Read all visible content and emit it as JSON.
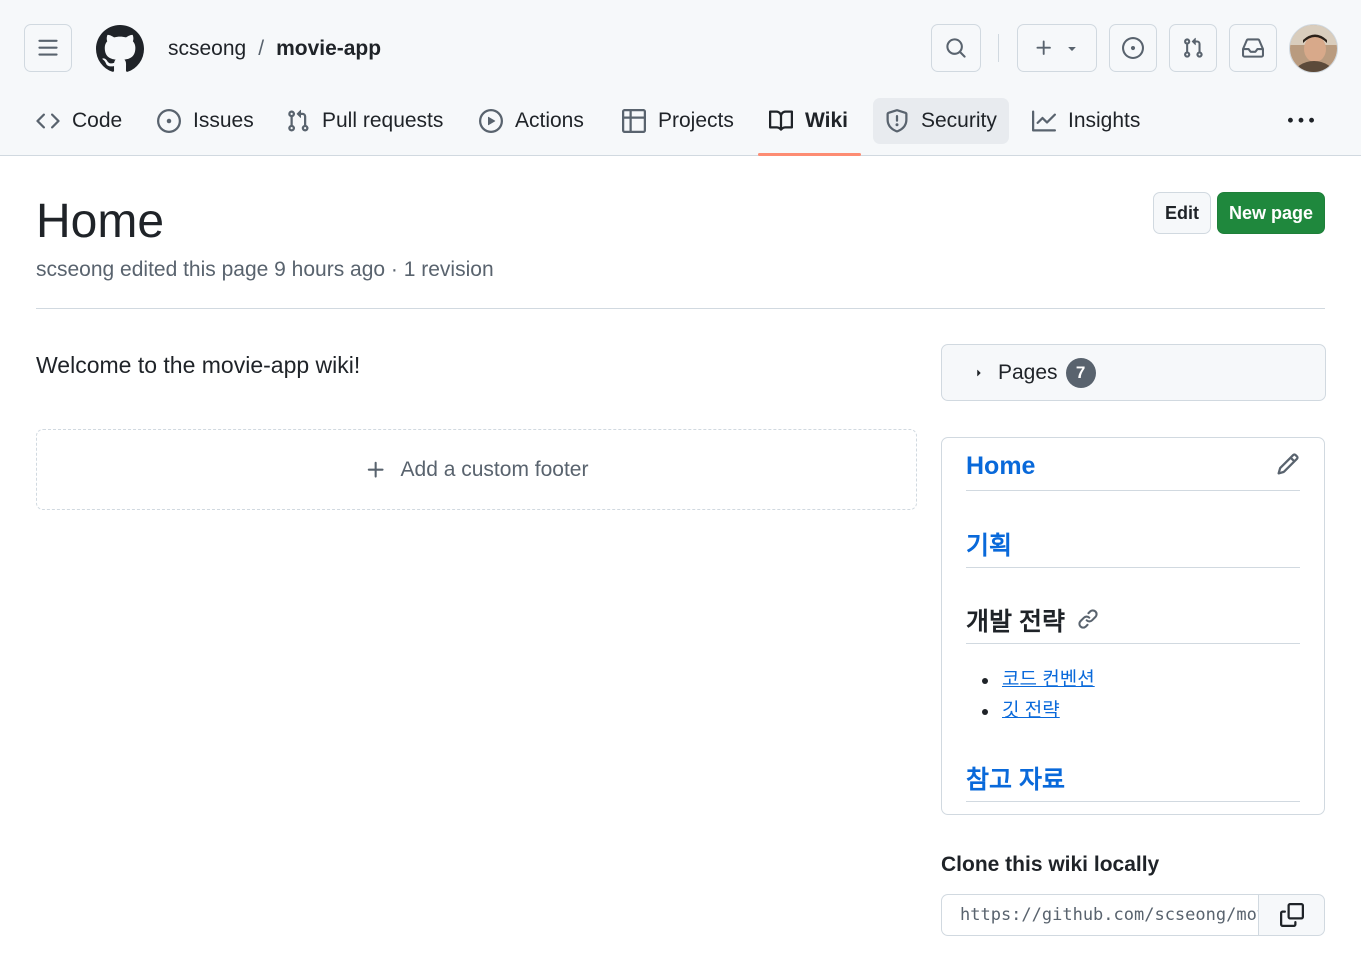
{
  "header": {
    "owner": "scseong",
    "separator": "/",
    "repo": "movie-app"
  },
  "nav": {
    "items": [
      {
        "label": "Code",
        "icon": "code-icon"
      },
      {
        "label": "Issues",
        "icon": "issue-opened-icon"
      },
      {
        "label": "Pull requests",
        "icon": "git-pull-request-icon"
      },
      {
        "label": "Actions",
        "icon": "play-icon"
      },
      {
        "label": "Projects",
        "icon": "table-icon"
      },
      {
        "label": "Wiki",
        "icon": "book-icon"
      },
      {
        "label": "Security",
        "icon": "shield-icon"
      },
      {
        "label": "Insights",
        "icon": "graph-icon"
      }
    ],
    "active": "Wiki"
  },
  "page": {
    "title": "Home",
    "meta": "scseong edited this page 9 hours ago · 1 revision",
    "edit_label": "Edit",
    "new_page_label": "New page",
    "welcome": "Welcome to the movie-app wiki!",
    "add_footer_label": "Add a custom footer"
  },
  "sidebar": {
    "pages_label": "Pages",
    "pages_count": "7",
    "home": "Home",
    "plan": "기획",
    "dev_strategy": "개발 전략",
    "links": [
      "코드 컨벤션",
      "깃 전략"
    ],
    "references": "참고 자료"
  },
  "clone": {
    "title": "Clone this wiki locally",
    "url": "https://github.com/scseong/movie-app.wiki.git"
  },
  "colors": {
    "accent_underline": "#fd8c73",
    "link": "#0969da",
    "primary_button": "#1f883d",
    "header_bg": "#f6f8fa"
  }
}
